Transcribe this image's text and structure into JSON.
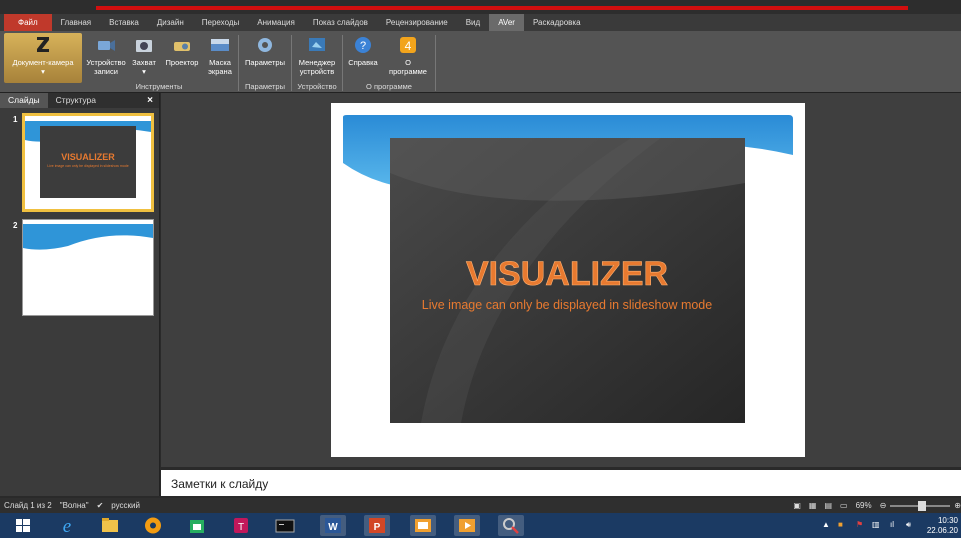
{
  "ribbon_tabs": [
    "Файл",
    "Главная",
    "Вставка",
    "Дизайн",
    "Переходы",
    "Анимация",
    "Показ слайдов",
    "Рецензирование",
    "Вид",
    "AVer",
    "Раскадровка"
  ],
  "ribbon": {
    "doc_camera": "Документ-камера",
    "record_device_1": "Устройство",
    "record_device_2": "записи",
    "capture": "Захват",
    "projector": "Проектор",
    "mask_1": "Маска",
    "mask_2": "экрана",
    "settings": "Параметры",
    "manager_1": "Менеджер",
    "manager_2": "устройств",
    "help": "Справка",
    "about_1": "О",
    "about_2": "программе",
    "group_tools": "Инструменты",
    "group_settings": "Параметры",
    "group_device": "Устройство",
    "group_about": "О программе"
  },
  "sidebar": {
    "tab_slides": "Слайды",
    "tab_outline": "Структура",
    "close": "×",
    "slide1_num": "1",
    "slide2_num": "2"
  },
  "slide": {
    "title": "VISUALIZER",
    "subtitle": "Live image can only be displayed in slideshow mode"
  },
  "notes_placeholder": "Заметки к слайду",
  "status": {
    "slide_info": "Слайд 1 из 2",
    "theme": "\"Волна\"",
    "language": "русский",
    "zoom": "69%"
  },
  "clock": {
    "time": "10:30",
    "date": "22.06.20"
  },
  "colors": {
    "file_tab": "#c0392b",
    "accent_red_line": "#d20f0f",
    "slide_title": "#e87a30",
    "taskbar": "#1b3a63"
  }
}
